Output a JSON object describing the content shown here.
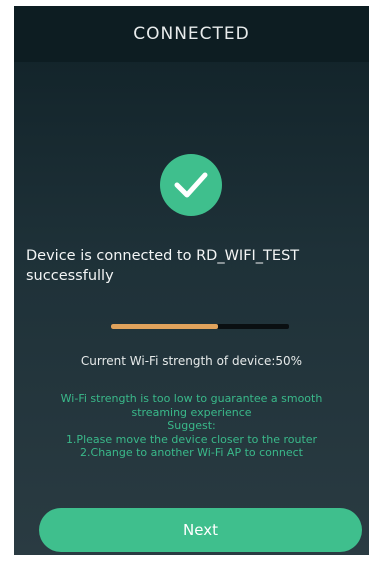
{
  "header": {
    "title": "CONNECTED"
  },
  "status": {
    "icon": "check-icon",
    "message": "Device is connected to RD_WIFI_TEST successfully"
  },
  "signal": {
    "strength_percent": 50,
    "strength_text": "Current Wi-Fi strength of device:50%"
  },
  "warning": {
    "line1": "Wi-Fi strength is too low to guarantee a smooth",
    "line2": "streaming experience",
    "suggest_label": "Suggest:",
    "tip1": "1.Please move the device closer to the router",
    "tip2": "2.Change to another Wi-Fi AP to connect"
  },
  "actions": {
    "next_label": "Next"
  },
  "colors": {
    "accent": "#3fbf8d",
    "progress": "#e0a35c",
    "background": "#1e3138"
  }
}
